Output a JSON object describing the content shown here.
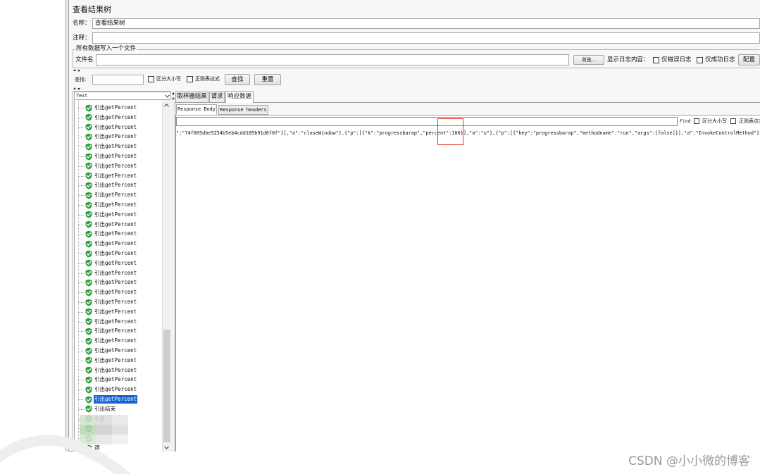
{
  "window": {
    "title": "查看结果树"
  },
  "form": {
    "name_label": "名称：",
    "name_value": "查看结果树",
    "comment_label": "注释："
  },
  "file_section": {
    "legend": "所有数据写入一个文件",
    "filename_label": "文件名",
    "browse_label": "浏览...",
    "log_label": "显示日志内容：",
    "errors_only_label": "仅错误日志",
    "errors_only_checked": false,
    "success_only_label": "仅成功日志",
    "success_only_checked": false,
    "configure_label": "配置"
  },
  "search": {
    "label": "查找:",
    "case_sensitive_label": "区分大小写",
    "case_sensitive_checked": false,
    "regex_label": "正则表达式",
    "regex_checked": false,
    "find_label": "查找",
    "reset_label": "重置"
  },
  "renderer": {
    "selected": "Text"
  },
  "tree": {
    "items": [
      {
        "label": "引出getPercent",
        "selected": false
      },
      {
        "label": "引出getPercent",
        "selected": false
      },
      {
        "label": "引出getPercent",
        "selected": false
      },
      {
        "label": "引出getPercent",
        "selected": false
      },
      {
        "label": "引出getPercent",
        "selected": false
      },
      {
        "label": "引出getPercent",
        "selected": false
      },
      {
        "label": "引出getPercent",
        "selected": false
      },
      {
        "label": "引出getPercent",
        "selected": false
      },
      {
        "label": "引出getPercent",
        "selected": false
      },
      {
        "label": "引出getPercent",
        "selected": false
      },
      {
        "label": "引出getPercent",
        "selected": false
      },
      {
        "label": "引出getPercent",
        "selected": false
      },
      {
        "label": "引出getPercent",
        "selected": false
      },
      {
        "label": "引出getPercent",
        "selected": false
      },
      {
        "label": "引出getPercent",
        "selected": false
      },
      {
        "label": "引出getPercent",
        "selected": false
      },
      {
        "label": "引出getPercent",
        "selected": false
      },
      {
        "label": "引出getPercent",
        "selected": false
      },
      {
        "label": "引出getPercent",
        "selected": false
      },
      {
        "label": "引出getPercent",
        "selected": false
      },
      {
        "label": "引出getPercent",
        "selected": false
      },
      {
        "label": "引出getPercent",
        "selected": false
      },
      {
        "label": "引出getPercent",
        "selected": false
      },
      {
        "label": "引出getPercent",
        "selected": false
      },
      {
        "label": "引出getPercent",
        "selected": false
      },
      {
        "label": "引出getPercent",
        "selected": false
      },
      {
        "label": "引出getPercent",
        "selected": false
      },
      {
        "label": "引出getPercent",
        "selected": false
      },
      {
        "label": "引出getPercent",
        "selected": false
      },
      {
        "label": "引出getPercent",
        "selected": false
      },
      {
        "label": "引出getPercent",
        "selected": true
      },
      {
        "label": "引出结束",
        "selected": false
      },
      {
        "label": "引出",
        "selected": false
      },
      {
        "label": "",
        "selected": false
      },
      {
        "label": "",
        "selected": false
      },
      {
        "label": "调",
        "selected": false
      }
    ]
  },
  "result_tabs": [
    {
      "label": "取样器结果",
      "selected": false
    },
    {
      "label": "请求",
      "selected": false
    },
    {
      "label": "响应数据",
      "selected": true
    }
  ],
  "response_tabs": [
    {
      "label": "Response Body",
      "selected": true
    },
    {
      "label": "Response headers",
      "selected": false
    }
  ],
  "response_search": {
    "find_label": "Find",
    "case_sensitive_label": "区分大小写",
    "case_sensitive_checked": false,
    "regex_label": "正则表达式",
    "regex_checked": false
  },
  "response_body": "\":\"74f605dbe5254b5eb4cdd185b91d6f0f\"}],\"a\":\"closeWindow\"},{\"p\":[{\"k\":\"progressbarap\",\"percent\":100}],\"a\":\"u\"},{\"p\":[{\"key\":\"progressbarap\",\"methodname\":\"run\",\"args\":[false]}],\"a\":\"InvokeControlMethod\"}",
  "watermark": "CSDN @小小微的博客",
  "colors": {
    "selection": "#1464d6",
    "success_icon": "#2f9e3f",
    "highlight_box": "#e8322b"
  }
}
